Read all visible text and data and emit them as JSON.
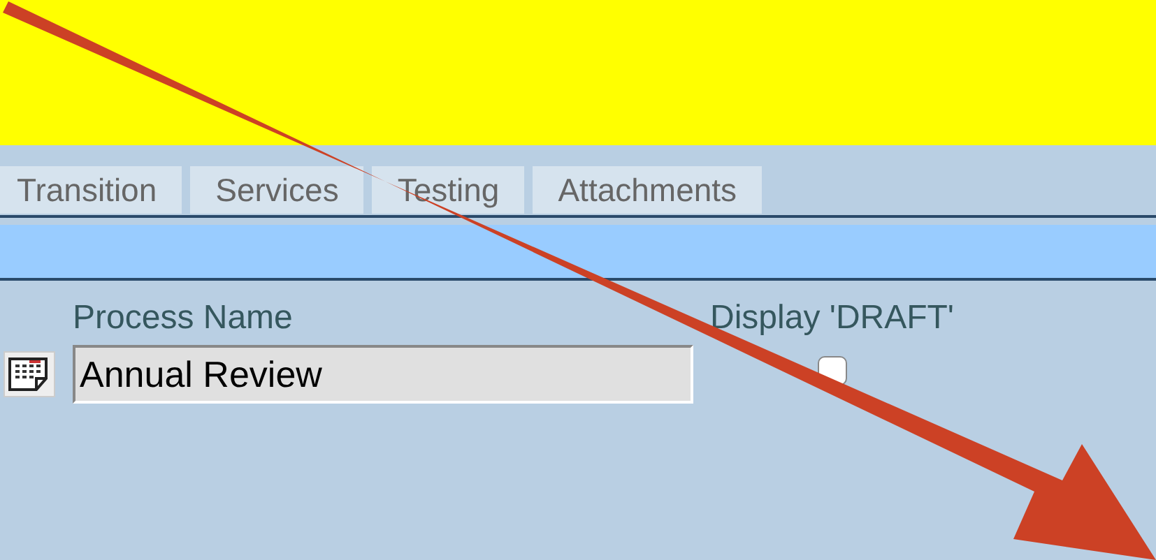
{
  "tabs": [
    {
      "label": "Transition",
      "selected": false
    },
    {
      "label": "Services",
      "selected": false
    },
    {
      "label": "Testing",
      "selected": false
    },
    {
      "label": "Attachments",
      "selected": false
    }
  ],
  "form": {
    "process_name": {
      "label": "Process Name",
      "value": "Annual Review"
    },
    "display_draft": {
      "label": "Display 'DRAFT'",
      "checked": false
    }
  }
}
